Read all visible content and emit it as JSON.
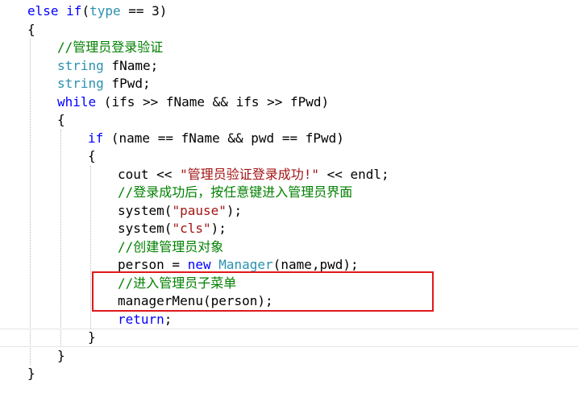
{
  "colors": {
    "keyword": "#0000ff",
    "type": "#2b91af",
    "comment": "#008000",
    "string": "#a31515",
    "plain": "#000000",
    "highlight_box": "#e0191c"
  },
  "code_lines": [
    {
      "indent": 0,
      "tokens": [
        {
          "t": "else",
          "c": "keyword"
        },
        {
          "t": " ",
          "c": "plain"
        },
        {
          "t": "if",
          "c": "keyword"
        },
        {
          "t": "(",
          "c": "plain"
        },
        {
          "t": "type",
          "c": "type"
        },
        {
          "t": " == 3)",
          "c": "plain"
        }
      ]
    },
    {
      "indent": 0,
      "tokens": [
        {
          "t": "{",
          "c": "plain"
        }
      ]
    },
    {
      "indent": 1,
      "tokens": [
        {
          "t": "//管理员登录验证",
          "c": "comment"
        }
      ]
    },
    {
      "indent": 1,
      "tokens": [
        {
          "t": "string",
          "c": "type"
        },
        {
          "t": " fName;",
          "c": "plain"
        }
      ]
    },
    {
      "indent": 1,
      "tokens": [
        {
          "t": "string",
          "c": "type"
        },
        {
          "t": " fPwd;",
          "c": "plain"
        }
      ]
    },
    {
      "indent": 1,
      "tokens": [
        {
          "t": "while",
          "c": "keyword"
        },
        {
          "t": " (ifs >> fName && ifs >> fPwd)",
          "c": "plain"
        }
      ]
    },
    {
      "indent": 1,
      "tokens": [
        {
          "t": "{",
          "c": "plain"
        }
      ]
    },
    {
      "indent": 2,
      "tokens": [
        {
          "t": "if",
          "c": "keyword"
        },
        {
          "t": " (name == fName && pwd == fPwd)",
          "c": "plain"
        }
      ]
    },
    {
      "indent": 2,
      "tokens": [
        {
          "t": "{",
          "c": "plain"
        }
      ]
    },
    {
      "indent": 3,
      "tokens": [
        {
          "t": "cout << ",
          "c": "plain"
        },
        {
          "t": "\"管理员验证登录成功!\"",
          "c": "string"
        },
        {
          "t": " << endl;",
          "c": "plain"
        }
      ]
    },
    {
      "indent": 3,
      "tokens": [
        {
          "t": "//登录成功后，按任意键进入管理员界面",
          "c": "comment"
        }
      ]
    },
    {
      "indent": 3,
      "tokens": [
        {
          "t": "system(",
          "c": "plain"
        },
        {
          "t": "\"pause\"",
          "c": "string"
        },
        {
          "t": ");",
          "c": "plain"
        }
      ]
    },
    {
      "indent": 3,
      "tokens": [
        {
          "t": "system(",
          "c": "plain"
        },
        {
          "t": "\"cls\"",
          "c": "string"
        },
        {
          "t": ");",
          "c": "plain"
        }
      ]
    },
    {
      "indent": 3,
      "tokens": [
        {
          "t": "//创建管理员对象",
          "c": "comment"
        }
      ]
    },
    {
      "indent": 3,
      "tokens": [
        {
          "t": "person = ",
          "c": "plain"
        },
        {
          "t": "new",
          "c": "keyword"
        },
        {
          "t": " ",
          "c": "plain"
        },
        {
          "t": "Manager",
          "c": "type"
        },
        {
          "t": "(name,pwd);",
          "c": "plain"
        }
      ]
    },
    {
      "indent": 3,
      "tokens": [
        {
          "t": "//进入管理员子菜单",
          "c": "comment"
        }
      ]
    },
    {
      "indent": 3,
      "tokens": [
        {
          "t": "managerMenu(person);",
          "c": "plain"
        }
      ]
    },
    {
      "indent": 3,
      "tokens": [
        {
          "t": "return",
          "c": "keyword"
        },
        {
          "t": ";",
          "c": "plain"
        }
      ]
    },
    {
      "indent": 2,
      "tokens": [
        {
          "t": "}",
          "c": "plain"
        }
      ]
    },
    {
      "indent": 1,
      "tokens": [
        {
          "t": "}",
          "c": "plain"
        }
      ]
    },
    {
      "indent": 0,
      "tokens": [
        {
          "t": "}",
          "c": "plain"
        }
      ]
    }
  ]
}
